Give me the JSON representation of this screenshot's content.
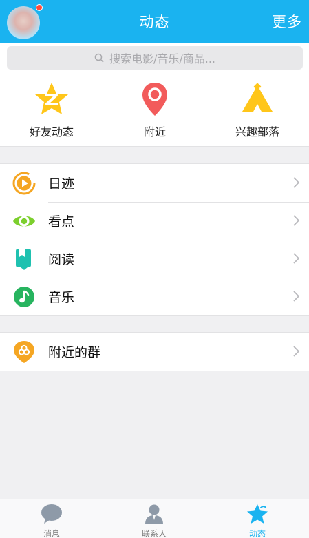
{
  "header": {
    "title": "动态",
    "more_label": "更多"
  },
  "search": {
    "placeholder": "搜索电影/音乐/商品..."
  },
  "quick_entries": [
    {
      "label": "好友动态",
      "icon": "qzone-star-icon"
    },
    {
      "label": "附近",
      "icon": "location-pin-icon"
    },
    {
      "label": "兴趣部落",
      "icon": "tent-icon"
    }
  ],
  "list": [
    {
      "label": "日迹",
      "icon": "play-circle-icon"
    },
    {
      "label": "看点",
      "icon": "eye-icon"
    },
    {
      "label": "阅读",
      "icon": "book-icon"
    },
    {
      "label": "音乐",
      "icon": "music-note-icon"
    }
  ],
  "list2": [
    {
      "label": "附近的群",
      "icon": "group-pin-icon"
    }
  ],
  "tabbar": {
    "tabs": [
      {
        "label": "消息",
        "icon": "chat-bubble-icon",
        "active": false
      },
      {
        "label": "联系人",
        "icon": "person-icon",
        "active": false
      },
      {
        "label": "动态",
        "icon": "star-icon",
        "active": true
      }
    ]
  },
  "colors": {
    "accent": "#1ab3f0",
    "badge": "#ff4b3a",
    "background": "#f0f0f2"
  }
}
